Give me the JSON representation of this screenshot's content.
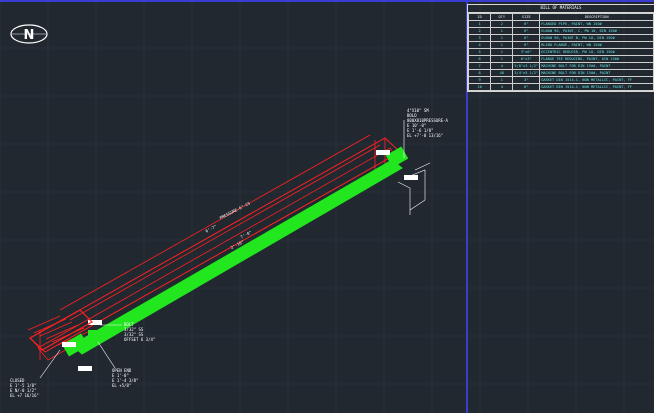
{
  "bom": {
    "title": "BILL OF MATERIALS",
    "headers": [
      "ID",
      "QTY",
      "SIZE",
      "DESCRIPTION"
    ],
    "rows": [
      {
        "id": "1",
        "qty": "2",
        "size": "6\"",
        "desc": "FLANGED PIPE, PAINT, WN 150#"
      },
      {
        "id": "2",
        "qty": "1",
        "size": "6\"",
        "desc": "ELBOW 90, PAINT, C, PW 10, DIN 150#"
      },
      {
        "id": "3",
        "qty": "1",
        "size": "6\"",
        "desc": "ELBOW 90, PAINT B, PW 10, DIN 150#"
      },
      {
        "id": "4",
        "qty": "1",
        "size": "6\"",
        "desc": "BLIND FLANGE, PAINT, WN 150#"
      },
      {
        "id": "5",
        "qty": "1",
        "size": "3\"x6\"",
        "desc": "ECCENTRIC REDUCER, PW 10, DIN 150#"
      },
      {
        "id": "6",
        "qty": "1",
        "size": "6\"x3\"",
        "desc": "FLANGE TEE REDUCING, PAINT, DIN 150#"
      },
      {
        "id": "7",
        "qty": "4",
        "size": "5/8\"x3 1/2\"",
        "desc": "MACHINE BOLT FOR DIN 150#, PAINT"
      },
      {
        "id": "8",
        "qty": "48",
        "size": "3/4\"x5 1/2\"",
        "desc": "MACHINE BOLT FOR DIN 150#, PAINT"
      },
      {
        "id": "9",
        "qty": "1",
        "size": "3\"",
        "desc": "GASKET DIN 1514-1, NON METALLIC, PAINT, FF"
      },
      {
        "id": "10",
        "qty": "4",
        "size": "6\"",
        "desc": "GASKET DIN 1514-1, NON METALLIC, PAINT, FF"
      }
    ]
  },
  "north_letter": "N",
  "colors": {
    "background": "#212830",
    "grid": "#2c3540",
    "pipe": "#22e61e",
    "dimension": "#ff2020",
    "frame": "#3a3ccf",
    "text": "#ffffff",
    "cyan": "#5fe8e8"
  },
  "annotations": {
    "top_callout": "4\"X10\" SM\nBOLD\n800X810PRESSURE-A\nE 10'-0\"\nE 1'-6 1/8\"\nEL +7'-0 13/16\"",
    "run_label": "PRESSURE-6\"-CS",
    "dim_long": "6'-7\"",
    "dim_mid": "7'-0\"",
    "dim_inner": "2'-10\"",
    "left_callout": "CLOSED\nE 1'-5 1/8\"\nE N/-0 1/2\"\nEL +7 16/16\"",
    "bottom_callout": "OPEN END\nE 1'-0\"\nE 1'-4 3/8\"\nEL +5/8\"",
    "mid_callout": "BOLT\n3/32\" SS\n3/32\" SS\nOFFSET 6 3/4\""
  }
}
